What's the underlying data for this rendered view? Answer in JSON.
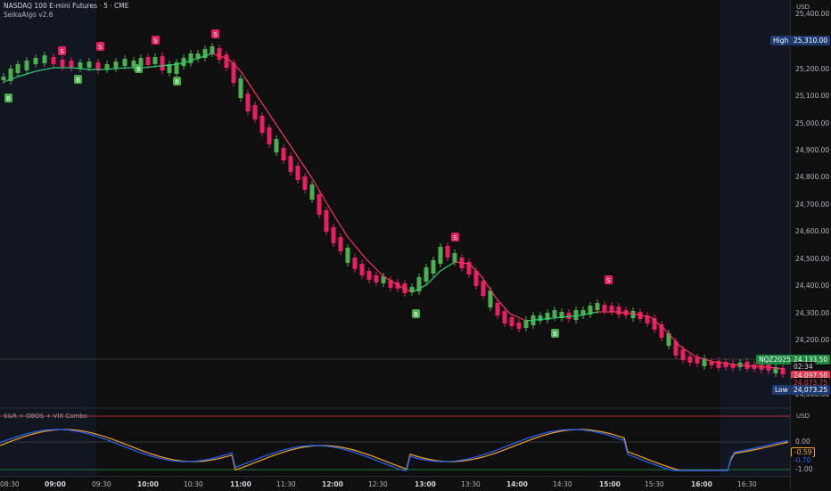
{
  "symbol": {
    "title": "NASDAQ 100 E-mini Futures · 5 · CME",
    "indicator": "SeikaAlgo v2.6"
  },
  "price_axis": {
    "currency": "USD",
    "labels": [
      "25,400.00",
      "25,200.00",
      "25,100.00",
      "25,000.00",
      "24,900.00",
      "24,800.00",
      "24,700.00",
      "24,600.00",
      "24,500.00",
      "24,400.00",
      "24,300.00",
      "24,200.00",
      "24,000.00"
    ]
  },
  "tags": {
    "high_label": "High",
    "high_value": "25,310.00",
    "contract": "NQZ2025",
    "last_price": "24,133.50",
    "countdown": "02:34",
    "price_a": "24,097.50",
    "price_b": "24,073.75",
    "low_label": "Low",
    "low_value": "24,073.25"
  },
  "oscillator": {
    "title": "S&R + OBOS + VIX Combo",
    "currency": "USD",
    "labels": [
      "0.00",
      "-0.59",
      "-0.70",
      "-1.00"
    ]
  },
  "time_axis": {
    "labels": [
      "08:30",
      "09:00",
      "09:30",
      "10:00",
      "10:30",
      "11:00",
      "11:30",
      "12:00",
      "12:30",
      "13:00",
      "13:30",
      "14:00",
      "14:30",
      "15:00",
      "15:30",
      "16:00",
      "16:30"
    ]
  },
  "signals": {
    "buy": "B",
    "sell": "S"
  },
  "colors": {
    "up": "#4caf50",
    "down": "#e91e63",
    "ma_up": "#2ecc71",
    "ma_down": "#f2385a",
    "high_tag": "#1e3a70",
    "last_tag": "#1b8a3c",
    "price_a": "#e53950",
    "osc_orange": "#f5a623",
    "osc_blue": "#2962ff"
  }
}
